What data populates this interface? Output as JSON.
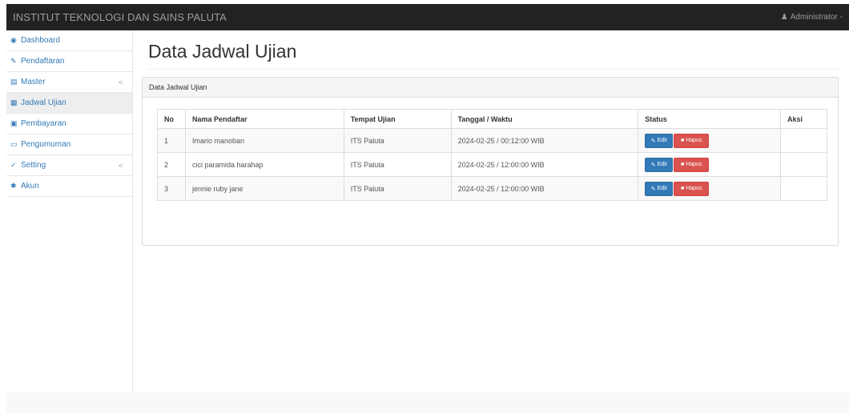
{
  "navbar": {
    "brand": "INSTITUT TEKNOLOGI DAN SAINS PALUTA",
    "user": "Administrator",
    "user_icon": "user-icon",
    "caret": "-"
  },
  "sidebar": {
    "items": [
      {
        "label": "Dashboard",
        "icon": "dashboard-icon",
        "glyph": "◉"
      },
      {
        "label": "Pendaftaran",
        "icon": "pencil-icon",
        "glyph": "✎"
      },
      {
        "label": "Master",
        "icon": "list-icon",
        "glyph": "▤",
        "caret": "<"
      },
      {
        "label": "Jadwal Ujian",
        "icon": "calendar-icon",
        "glyph": "▦"
      },
      {
        "label": "Pembayaran",
        "icon": "payment-icon",
        "glyph": "▣"
      },
      {
        "label": "Pengumuman",
        "icon": "document-icon",
        "glyph": "▭"
      },
      {
        "label": "Setting",
        "icon": "wrench-icon",
        "glyph": "✓",
        "caret": "<"
      },
      {
        "label": "Akun",
        "icon": "gear-icon",
        "glyph": "✱"
      }
    ],
    "active_index": 3
  },
  "main": {
    "title": "Data Jadwal Ujian",
    "panel_heading": "Data Jadwal Ujian",
    "table": {
      "headers": [
        "No",
        "Nama Pendaftar",
        "Tempat Ujian",
        "Tanggal / Waktu",
        "Status",
        "Aksi"
      ],
      "rows": [
        {
          "no": "1",
          "nama": "Imario manoban",
          "tempat": "ITS Paluta",
          "waktu": "2024-02-25 / 00:12:00 WIB"
        },
        {
          "no": "2",
          "nama": "cici paramida harahap",
          "tempat": "ITS Paluta",
          "waktu": "2024-02-25 / 12:00:00 WIB"
        },
        {
          "no": "3",
          "nama": "jennie ruby jane",
          "tempat": "ITS Paluta",
          "waktu": "2024-02-25 / 12:00:00 WIB"
        }
      ],
      "edit_label": "Edit",
      "hapus_label": "Hapus"
    }
  },
  "colors": {
    "navbar": "#222222",
    "link": "#337ab7",
    "edit": "#337ab7",
    "hapus": "#d9534f"
  }
}
